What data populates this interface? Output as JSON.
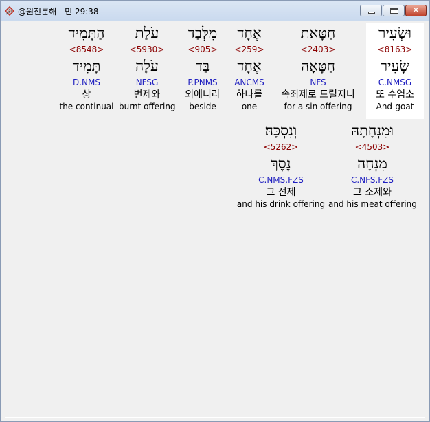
{
  "window": {
    "title": "@원전분해 - 민 29:38",
    "controls": {
      "minimize": "",
      "maximize": "",
      "close": "✕"
    }
  },
  "words": [
    {
      "hebrew": "וּשְׂעִיר",
      "strong": "<8163>",
      "lemma": "שָׂעִיר",
      "parse": "C.NMSG",
      "korean": "또 수염소",
      "english": "And-goat"
    },
    {
      "hebrew": "חַטָּאת",
      "strong": "<2403>",
      "lemma": "חַטָּאָה",
      "parse": "NFS",
      "korean": "속죄제로 드릴지니",
      "english": "for a sin offering"
    },
    {
      "hebrew": "אֶחָד",
      "strong": "<259>",
      "lemma": "אֶחָד",
      "parse": "ANCMS",
      "korean": "하나를",
      "english": "one"
    },
    {
      "hebrew": "מִלְּבַד",
      "strong": "<905>",
      "lemma": "בַּד",
      "parse": "P.PNMS",
      "korean": "외에니라",
      "english": "beside"
    },
    {
      "hebrew": "עֹלַת",
      "strong": "<5930>",
      "lemma": "עֹלָה",
      "parse": "NFSG",
      "korean": "번제와",
      "english": "burnt offering"
    },
    {
      "hebrew": "הַתָּמִיד",
      "strong": "<8548>",
      "lemma": "תָּמִיד",
      "parse": "D.NMS",
      "korean": "상",
      "english": "the continual"
    },
    {
      "hebrew": "וּמִנְחָתָהּ",
      "strong": "<4503>",
      "lemma": "מִנְחָה",
      "parse": "C.NFS.FZS",
      "korean": "그 소제와",
      "english": "and his meat offering"
    },
    {
      "hebrew": "וְנִסְכָּהּ׃",
      "strong": "<5262>",
      "lemma": "נֶסֶךְ",
      "parse": "C.NMS.FZS",
      "korean": "그 전제",
      "english": "and his drink offering"
    }
  ],
  "colors": {
    "strong_number": "#8b0000",
    "parse_code": "#2020c0",
    "selected_word_bg": "#ffffff"
  }
}
